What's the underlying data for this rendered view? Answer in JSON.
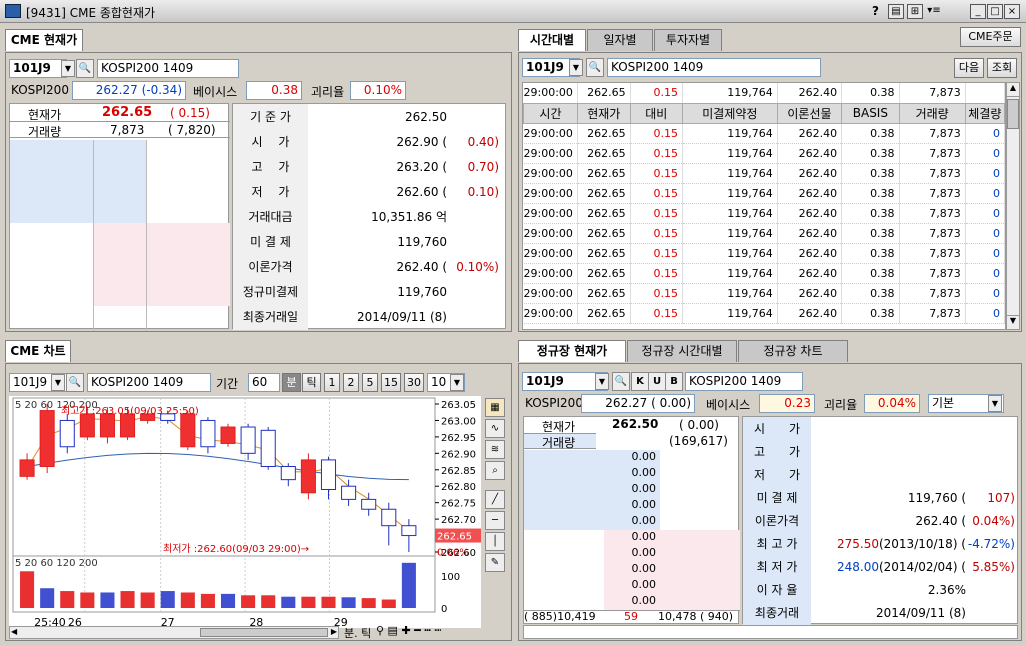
{
  "window": {
    "title": "[9431] CME 종합현재가",
    "help": "?"
  },
  "cme_current": {
    "tab": "CME 현재가",
    "code": "101J9",
    "name": "KOSPI200 1409",
    "kospi_label": "KOSPI200",
    "kospi_value": "262.27 (-0.34)",
    "basis_label": "베이시스",
    "basis_value": "0.38",
    "gap_label": "괴리율",
    "gap_value": "0.10%",
    "price_label": "현재가",
    "price": "262.65",
    "price_change": "( 0.15)",
    "volume_label": "거래량",
    "volume": "7,873",
    "volume2": "( 7,820)",
    "stats": [
      {
        "label": "기 준 가",
        "value": "262.50",
        "chg": ""
      },
      {
        "label": "시　 가",
        "value": "262.90 (",
        "chg": "0.40)"
      },
      {
        "label": "고　 가",
        "value": "263.20 (",
        "chg": "0.70)"
      },
      {
        "label": "저　 가",
        "value": "262.60 (",
        "chg": "0.10)"
      },
      {
        "label": "거래대금",
        "value": "10,351.86 억",
        "chg": ""
      },
      {
        "label": "미 결 제",
        "value": "119,760",
        "chg": ""
      },
      {
        "label": "이론가격",
        "value": "262.40 (",
        "chg": "0.10%)"
      },
      {
        "label": "정규미결제",
        "value": "119,760",
        "chg": ""
      },
      {
        "label": "최종거래일",
        "value": "2014/09/11 (8)",
        "chg": ""
      }
    ]
  },
  "time_table": {
    "tabs": [
      "시간대별",
      "일자별",
      "투자자별"
    ],
    "order_button": "CME주문",
    "code": "101J9",
    "name": "KOSPI200 1409",
    "next_button": "다음",
    "query_button": "조회",
    "summary": [
      "29:00:00",
      "262.65",
      "0.15",
      "119,764",
      "262.40",
      "0.38",
      "7,873",
      ""
    ],
    "columns": [
      "시간",
      "현재가",
      "대비",
      "미결제약정",
      "이론선물",
      "BASIS",
      "거래량",
      "체결량"
    ],
    "rows": [
      [
        "29:00:00",
        "262.65",
        "0.15",
        "119,764",
        "262.40",
        "0.38",
        "7,873",
        "0"
      ],
      [
        "29:00:00",
        "262.65",
        "0.15",
        "119,764",
        "262.40",
        "0.38",
        "7,873",
        "0"
      ],
      [
        "29:00:00",
        "262.65",
        "0.15",
        "119,764",
        "262.40",
        "0.38",
        "7,873",
        "0"
      ],
      [
        "29:00:00",
        "262.65",
        "0.15",
        "119,764",
        "262.40",
        "0.38",
        "7,873",
        "0"
      ],
      [
        "29:00:00",
        "262.65",
        "0.15",
        "119,764",
        "262.40",
        "0.38",
        "7,873",
        "0"
      ],
      [
        "29:00:00",
        "262.65",
        "0.15",
        "119,764",
        "262.40",
        "0.38",
        "7,873",
        "0"
      ],
      [
        "29:00:00",
        "262.65",
        "0.15",
        "119,764",
        "262.40",
        "0.38",
        "7,873",
        "0"
      ],
      [
        "29:00:00",
        "262.65",
        "0.15",
        "119,764",
        "262.40",
        "0.38",
        "7,873",
        "0"
      ],
      [
        "29:00:00",
        "262.65",
        "0.15",
        "119,764",
        "262.40",
        "0.38",
        "7,873",
        "0"
      ],
      [
        "29:00:00",
        "262.65",
        "0.15",
        "119,764",
        "262.40",
        "0.38",
        "7,873",
        "0"
      ]
    ]
  },
  "cme_chart": {
    "tab": "CME 차트",
    "code": "101J9",
    "name": "KOSPI200 1409",
    "period_label": "기간",
    "period": "60",
    "unit_min": "분",
    "unit_tick": "틱",
    "intervals": [
      "1",
      "2",
      "5",
      "15",
      "30"
    ],
    "interval_value": "10",
    "legend_price": "5 20 60 120 200",
    "legend_volume": "5 20 60 120 200",
    "high_note": "최고가 :263.05(09/03 25:50)",
    "low_note": "최저가 :262.60(09/03 29:00)→",
    "current_tag": "262.65",
    "pct_tag": "0.06%",
    "xlabels": [
      "25:40",
      "26",
      "27",
      "28",
      "29"
    ],
    "bottom_labels": "분. 틱"
  },
  "chart_data": {
    "type": "candlestick",
    "title": "",
    "ylim": [
      262.6,
      263.05
    ],
    "y_ticks": [
      "263.05",
      "263.00",
      "262.95",
      "262.90",
      "262.85",
      "262.80",
      "262.75",
      "262.70",
      "262.65",
      "262.60"
    ],
    "volume_ticks": [
      "100",
      "0"
    ],
    "x_labels": [
      "25:40",
      "26",
      "27",
      "28",
      "29"
    ],
    "candles": [
      {
        "o": 262.83,
        "c": 262.88,
        "h": 262.9,
        "l": 262.82,
        "up": true
      },
      {
        "o": 262.86,
        "c": 263.03,
        "h": 263.05,
        "l": 262.84,
        "up": true
      },
      {
        "o": 263.0,
        "c": 262.92,
        "h": 263.02,
        "l": 262.9,
        "up": false
      },
      {
        "o": 262.95,
        "c": 263.02,
        "h": 263.04,
        "l": 262.94,
        "up": true
      },
      {
        "o": 262.95,
        "c": 263.02,
        "h": 263.04,
        "l": 262.93,
        "up": true
      },
      {
        "o": 262.95,
        "c": 263.02,
        "h": 263.04,
        "l": 262.94,
        "up": true
      },
      {
        "o": 263.0,
        "c": 263.02,
        "h": 263.03,
        "l": 262.99,
        "up": true
      },
      {
        "o": 263.02,
        "c": 263.0,
        "h": 263.03,
        "l": 262.99,
        "up": false
      },
      {
        "o": 262.92,
        "c": 263.02,
        "h": 263.03,
        "l": 262.91,
        "up": true
      },
      {
        "o": 263.0,
        "c": 262.92,
        "h": 263.01,
        "l": 262.9,
        "up": false
      },
      {
        "o": 262.93,
        "c": 262.98,
        "h": 262.99,
        "l": 262.92,
        "up": true
      },
      {
        "o": 262.98,
        "c": 262.9,
        "h": 262.99,
        "l": 262.88,
        "up": false
      },
      {
        "o": 262.97,
        "c": 262.86,
        "h": 262.98,
        "l": 262.85,
        "up": false
      },
      {
        "o": 262.86,
        "c": 262.82,
        "h": 262.87,
        "l": 262.8,
        "up": false
      },
      {
        "o": 262.88,
        "c": 262.78,
        "h": 262.9,
        "l": 262.76,
        "up": true
      },
      {
        "o": 262.88,
        "c": 262.79,
        "h": 262.89,
        "l": 262.76,
        "up": false
      },
      {
        "o": 262.8,
        "c": 262.76,
        "h": 262.82,
        "l": 262.74,
        "up": false
      },
      {
        "o": 262.76,
        "c": 262.73,
        "h": 262.78,
        "l": 262.71,
        "up": false
      },
      {
        "o": 262.73,
        "c": 262.68,
        "h": 262.75,
        "l": 262.62,
        "up": false
      },
      {
        "o": 262.68,
        "c": 262.65,
        "h": 262.7,
        "l": 262.6,
        "up": false
      }
    ],
    "volumes": [
      130,
      70,
      60,
      55,
      55,
      60,
      55,
      60,
      55,
      50,
      50,
      45,
      45,
      40,
      40,
      40,
      38,
      35,
      30,
      160
    ]
  },
  "regular": {
    "tabs": [
      "정규장 현재가",
      "정규장 시간대별",
      "정규장 차트"
    ],
    "code": "101J9",
    "btn_k": "K",
    "btn_u": "U",
    "btn_b": "B",
    "name": "KOSPI200 1409",
    "kospi_label": "KOSPI200",
    "kospi_value": "262.27 ( 0.00)",
    "basis_label": "베이시스",
    "basis_value": "0.23",
    "gap_label": "괴리율",
    "gap_value": "0.04%",
    "mode": "기본",
    "price_label": "현재가",
    "price": "262.50",
    "price_chg": "( 0.00)",
    "volume_label": "거래량",
    "volume": "(169,617)",
    "depth": [
      "0.00",
      "0.00",
      "0.00",
      "0.00",
      "0.00",
      "0.00",
      "0.00",
      "0.00",
      "0.00",
      "0.00"
    ],
    "bottom_left": "( 885)10,419",
    "bottom_mid": "59",
    "bottom_right": "10,478 ( 940)",
    "stats": [
      {
        "label": "시　　가",
        "value": "",
        "chg": ""
      },
      {
        "label": "고　　가",
        "value": "",
        "chg": ""
      },
      {
        "label": "저　　가",
        "value": "",
        "chg": ""
      },
      {
        "label": "미 결 제",
        "value": "119,760 (",
        "chg": "107)"
      },
      {
        "label": "이론가격",
        "value": "262.40 (",
        "chg": "0.04%)"
      },
      {
        "label": "최 고 가",
        "value": "275.50",
        "value2": "(2013/10/18) (",
        "chg": "-4.72%)"
      },
      {
        "label": "최 저 가",
        "value": "248.00",
        "value2": "(2014/02/04) (",
        "chg": "5.85%)"
      },
      {
        "label": "이 자 율",
        "value": "2.36%",
        "chg": ""
      },
      {
        "label": "최종거래",
        "value": "2014/09/11 (8)",
        "chg": ""
      }
    ]
  }
}
